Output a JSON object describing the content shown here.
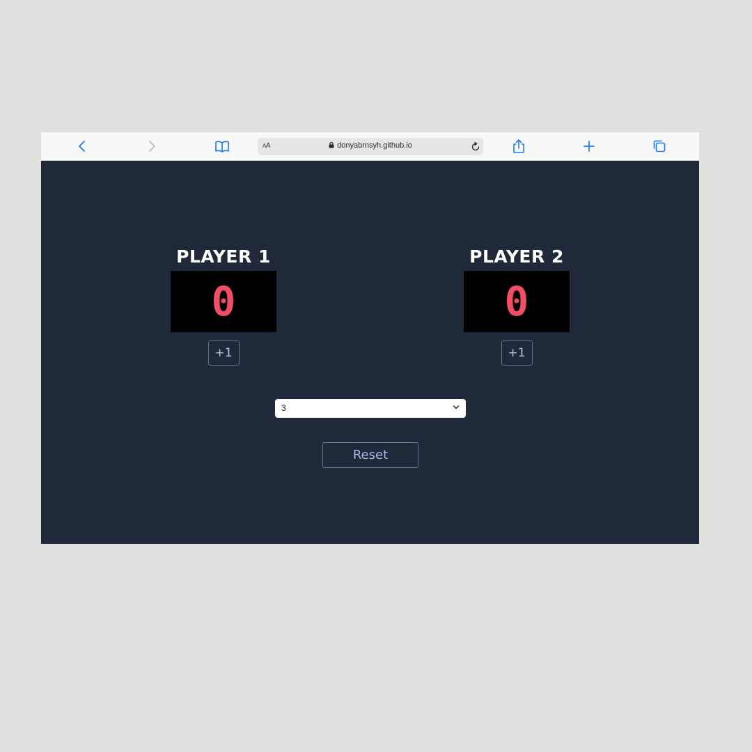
{
  "browser": {
    "reader_text_small": "A",
    "reader_text_large": "A",
    "url": "donyabrnsyh.github.io",
    "icons": {
      "back": "chevron-left-icon",
      "forward": "chevron-right-icon",
      "bookmarks": "book-icon",
      "lock": "lock-icon",
      "reload": "reload-icon",
      "share": "share-icon",
      "new_tab": "plus-icon",
      "tabs": "tabs-icon"
    },
    "accent_color": "#1a7cf0"
  },
  "game": {
    "players": [
      {
        "name": "PLAYER 1",
        "score": "0",
        "add_label": "+1"
      },
      {
        "name": "PLAYER 2",
        "score": "0",
        "add_label": "+1"
      }
    ],
    "playing_to": "3",
    "reset_label": "Reset",
    "colors": {
      "background": "#202939",
      "score_color": "#f24d66",
      "button_text": "#a9b8ec"
    }
  }
}
